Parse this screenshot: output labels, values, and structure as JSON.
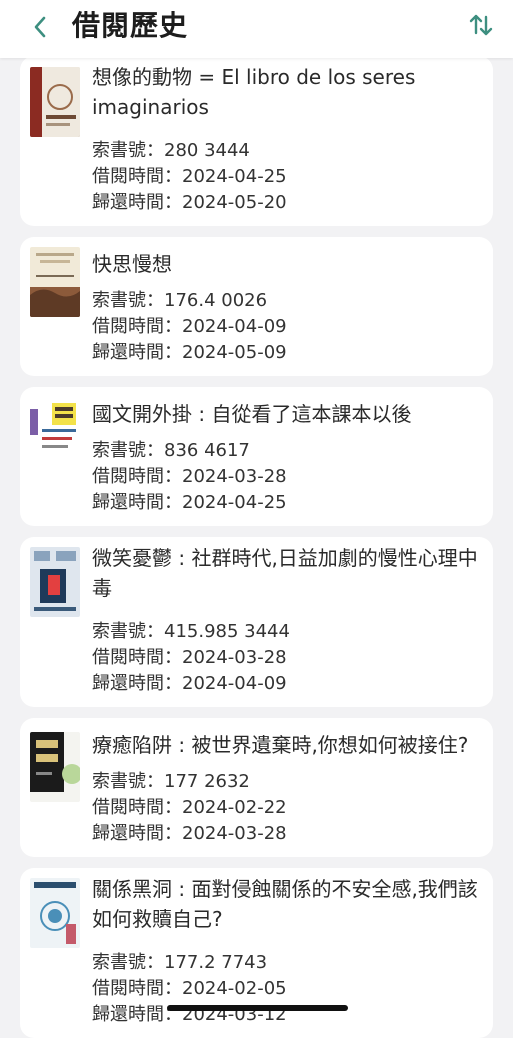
{
  "header": {
    "title": "借閱歷史",
    "back_icon": "chevron-left-icon",
    "sort_icon": "sort-arrows-icon",
    "accent": "#3d8f80"
  },
  "labels": {
    "call_number": "索書號：",
    "borrow_time": "借閱時間：",
    "return_time": "歸還時間："
  },
  "books": [
    {
      "title": "想像的動物 = El libro de los seres imaginarios",
      "call_number": "280 3444",
      "borrowed": "2024-04-25",
      "returned": "2024-05-20"
    },
    {
      "title": "快思慢想",
      "call_number": "176.4 0026",
      "borrowed": "2024-04-09",
      "returned": "2024-05-09"
    },
    {
      "title": "國文開外掛 : 自從看了這本課本以後",
      "call_number": "836 4617",
      "borrowed": "2024-03-28",
      "returned": "2024-04-25"
    },
    {
      "title": "微笑憂鬱 : 社群時代,日益加劇的慢性心理中毒",
      "call_number": "415.985 3444",
      "borrowed": "2024-03-28",
      "returned": "2024-04-09"
    },
    {
      "title": "療癒陷阱 : 被世界遺棄時,你想如何被接住?",
      "call_number": "177 2632",
      "borrowed": "2024-02-22",
      "returned": "2024-03-28"
    },
    {
      "title": "關係黑洞 : 面對侵蝕關係的不安全感,我們該如何救贖自己?",
      "call_number": "177.2 7743",
      "borrowed": "2024-02-05",
      "returned": "2024-03-12"
    }
  ]
}
